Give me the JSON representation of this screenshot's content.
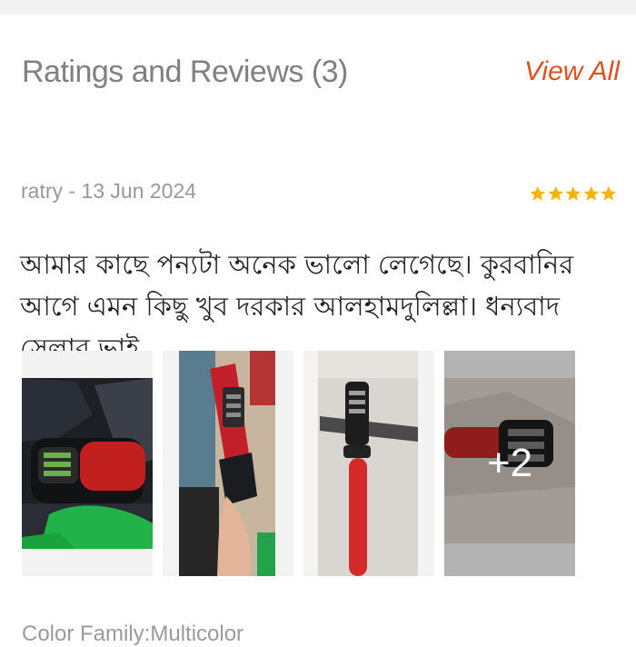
{
  "section": {
    "title": "Ratings and Reviews (3)",
    "view_all": "View All"
  },
  "review": {
    "meta": "ratry - 13 Jun 2024",
    "rating": 5,
    "text": "আমার কাছে পন্যটা অনেক ভালো লেগেছে। কুরবানির আগে এমন কিছু খুব দরকার আলহামদুলিল্লা। ধন্যবাদ সেলার ভাই",
    "more_images": "+2"
  },
  "footer": {
    "text": "Color Family:Multicolor"
  },
  "colors": {
    "accent": "#e0501e",
    "star": "#f5b400"
  }
}
